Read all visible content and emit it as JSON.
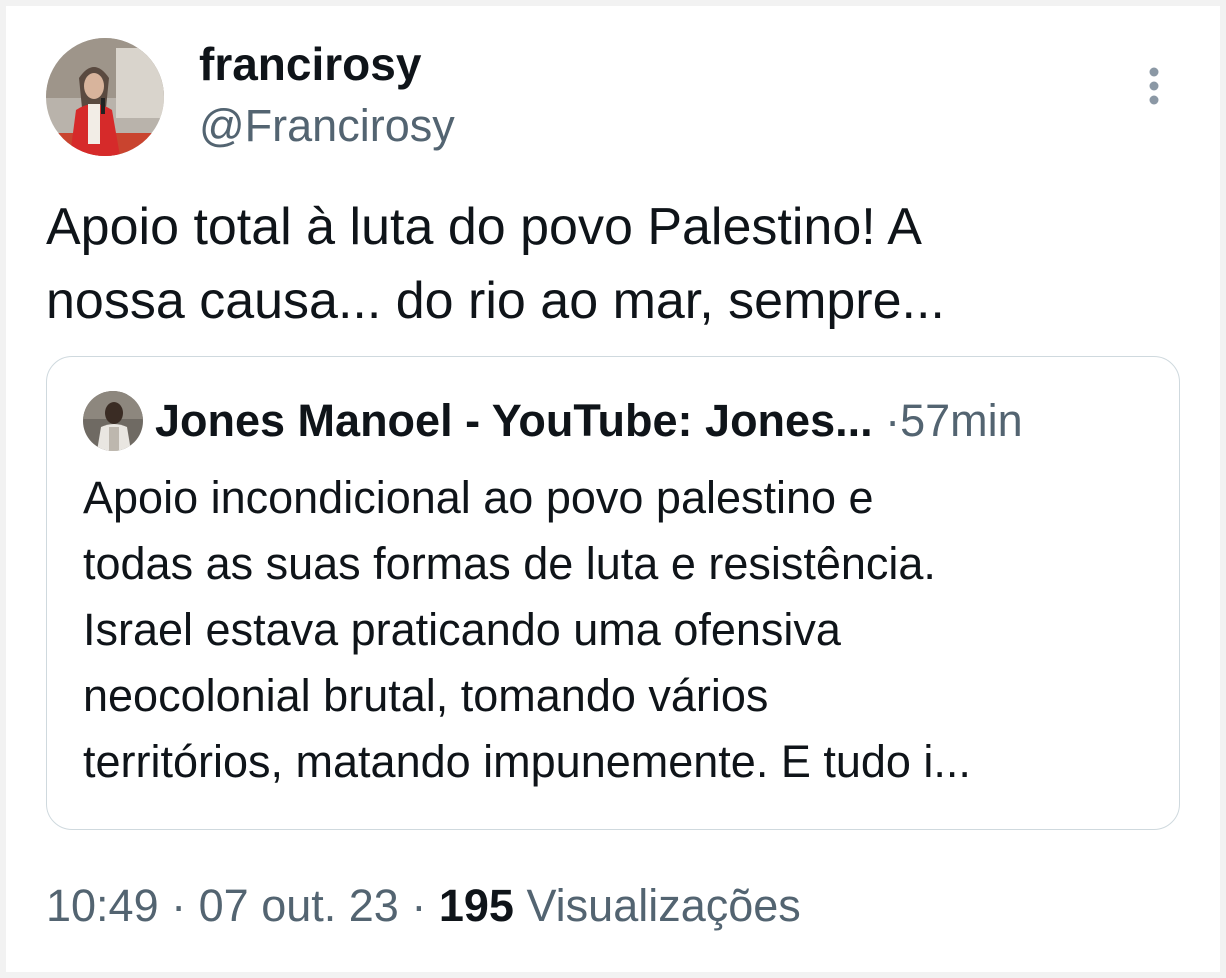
{
  "author": {
    "display_name": "francirosy",
    "handle": "@Francirosy",
    "avatar_icon": "profile-photo-avatar"
  },
  "tweet": {
    "text_lines": [
      "Apoio total à luta do povo Palestino! A",
      "nossa causa... do rio ao mar, sempre..."
    ]
  },
  "quoted_tweet": {
    "display_name": "Jones Manoel - YouTube: Jones...",
    "separator": "·",
    "time": "57min",
    "avatar_icon": "profile-photo-avatar",
    "text_lines": [
      "Apoio incondicional ao povo palestino e",
      "todas as suas formas de luta e resistência.",
      "Israel estava praticando uma ofensiva",
      "neocolonial brutal, tomando vários",
      "territórios, matando impunemente. E tudo i..."
    ]
  },
  "meta": {
    "time": "10:49",
    "sep1": "·",
    "date": "07 out. 23",
    "sep2": "·",
    "views_count": "195",
    "views_label": "Visualizações"
  },
  "colors": {
    "text_primary": "#0f1419",
    "text_secondary": "#536471",
    "border": "#cfd9de"
  },
  "icons": {
    "more": "more-vertical-icon"
  }
}
